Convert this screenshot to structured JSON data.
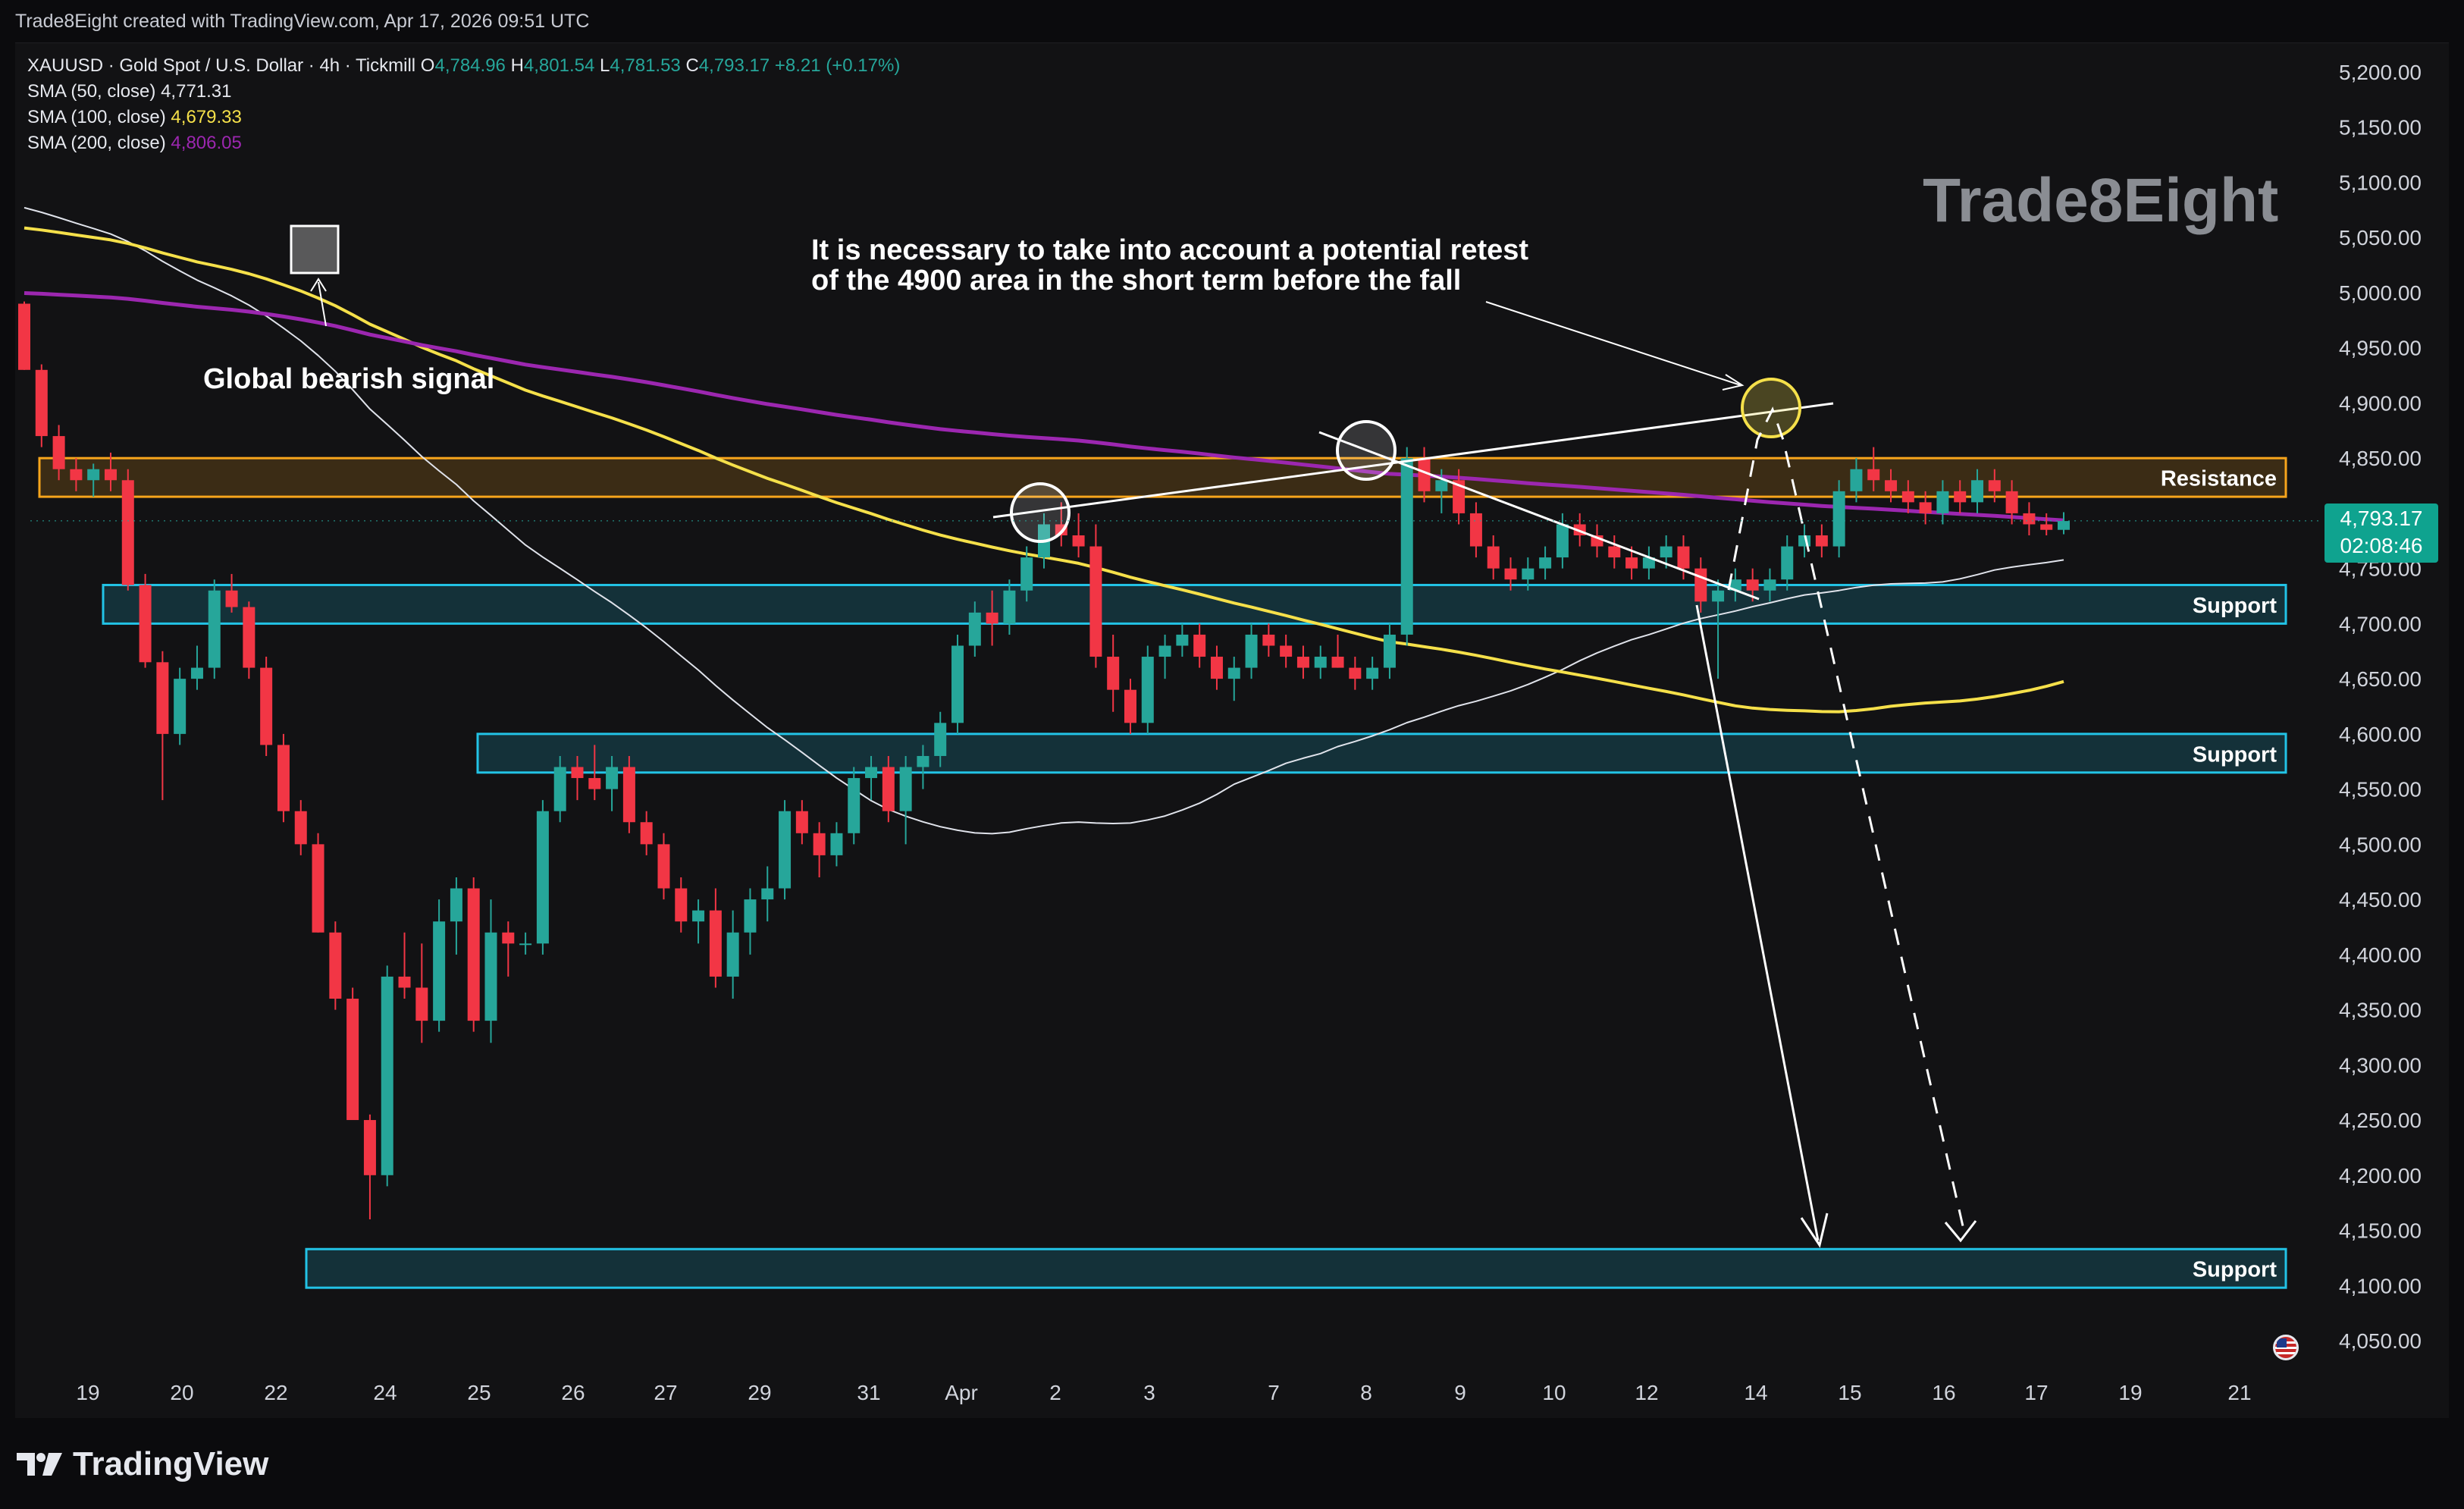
{
  "header": {
    "credit": "Trade8Eight created with TradingView.com, Apr 17, 2026 09:51 UTC"
  },
  "legend": {
    "symbol_line": "XAUUSD · Gold Spot / U.S. Dollar · 4h · Tickmill",
    "open_label": "O",
    "open": "4,784.96",
    "high_label": "H",
    "high": "4,801.54",
    "low_label": "L",
    "low": "4,781.53",
    "close_label": "C",
    "close": "4,793.17",
    "change": "+8.21 (+0.17%)",
    "sma50_label": "SMA (50, close)",
    "sma50_value": "4,771.31",
    "sma100_label": "SMA (100, close)",
    "sma100_value": "4,679.33",
    "sma200_label": "SMA (200, close)",
    "sma200_value": "4,806.05"
  },
  "brand": "Trade8Eight",
  "price_tag": {
    "price": "4,793.17",
    "countdown": "02:08:46"
  },
  "footer": {
    "logo_text": "TradingView"
  },
  "colors": {
    "up": "#26a69a",
    "down": "#f23645",
    "sma50": "#e0e3eb",
    "sma100": "#f5e04a",
    "sma200": "#9c27b0",
    "resistance": "#f7a51c",
    "support": "#22c3e6"
  },
  "chart_data": {
    "type": "candlestick",
    "symbol": "XAUUSD",
    "timeframe": "4h",
    "y_axis": {
      "ticks": [
        "5,200.00",
        "5,150.00",
        "5,100.00",
        "5,050.00",
        "5,000.00",
        "4,950.00",
        "4,900.00",
        "4,850.00",
        "4,800.00",
        "4,750.00",
        "4,700.00",
        "4,650.00",
        "4,600.00",
        "4,550.00",
        "4,500.00",
        "4,450.00",
        "4,400.00",
        "4,350.00",
        "4,300.00",
        "4,250.00",
        "4,200.00",
        "4,150.00",
        "4,100.00",
        "4,050.00"
      ],
      "range": [
        4020,
        5220
      ]
    },
    "x_axis": {
      "labels": [
        "19",
        "20",
        "22",
        "24",
        "25",
        "26",
        "27",
        "29",
        "31",
        "Apr",
        "2",
        "3",
        "7",
        "8",
        "9",
        "10",
        "12",
        "14",
        "15",
        "16",
        "17",
        "19",
        "21"
      ]
    },
    "zones": [
      {
        "label": "Resistance",
        "low": 4815,
        "high": 4850,
        "kind": "resistance"
      },
      {
        "label": "Support",
        "low": 4700,
        "high": 4735,
        "kind": "support"
      },
      {
        "label": "Support",
        "low": 4565,
        "high": 4600,
        "kind": "support"
      },
      {
        "label": "Support",
        "low": 4098,
        "high": 4133,
        "kind": "support"
      }
    ],
    "annotations": {
      "bearish_signal": "Global bearish signal",
      "retest_note_line1": "It is necessary to take into account a potential retest",
      "retest_note_line2": "of the 4900 area in the short term before the fall"
    },
    "candles": [
      [
        0,
        4990,
        4992,
        4930,
        4930
      ],
      [
        1,
        4930,
        4935,
        4860,
        4870
      ],
      [
        2,
        4870,
        4880,
        4830,
        4840
      ],
      [
        3,
        4840,
        4850,
        4820,
        4830
      ],
      [
        4,
        4830,
        4845,
        4815,
        4840
      ],
      [
        5,
        4840,
        4855,
        4820,
        4830
      ],
      [
        6,
        4830,
        4840,
        4730,
        4735
      ],
      [
        7,
        4735,
        4745,
        4660,
        4665
      ],
      [
        8,
        4665,
        4675,
        4540,
        4600
      ],
      [
        9,
        4600,
        4660,
        4590,
        4650
      ],
      [
        10,
        4650,
        4680,
        4640,
        4660
      ],
      [
        11,
        4660,
        4740,
        4650,
        4730
      ],
      [
        12,
        4730,
        4745,
        4710,
        4715
      ],
      [
        13,
        4715,
        4720,
        4650,
        4660
      ],
      [
        14,
        4660,
        4670,
        4580,
        4590
      ],
      [
        15,
        4590,
        4600,
        4520,
        4530
      ],
      [
        16,
        4530,
        4540,
        4490,
        4500
      ],
      [
        17,
        4500,
        4510,
        4420,
        4420
      ],
      [
        18,
        4420,
        4430,
        4350,
        4360
      ],
      [
        19,
        4360,
        4370,
        4260,
        4250
      ],
      [
        20,
        4250,
        4255,
        4160,
        4200
      ],
      [
        21,
        4200,
        4390,
        4190,
        4380
      ],
      [
        22,
        4380,
        4420,
        4360,
        4370
      ],
      [
        23,
        4370,
        4410,
        4320,
        4340
      ],
      [
        24,
        4340,
        4450,
        4330,
        4430
      ],
      [
        25,
        4430,
        4470,
        4400,
        4460
      ],
      [
        26,
        4460,
        4470,
        4330,
        4340
      ],
      [
        27,
        4340,
        4450,
        4320,
        4420
      ],
      [
        28,
        4420,
        4430,
        4380,
        4410
      ],
      [
        29,
        4410,
        4420,
        4400,
        4410
      ],
      [
        30,
        4410,
        4540,
        4400,
        4530
      ],
      [
        31,
        4530,
        4580,
        4520,
        4570
      ],
      [
        32,
        4570,
        4580,
        4540,
        4560
      ],
      [
        33,
        4560,
        4590,
        4540,
        4550
      ],
      [
        34,
        4550,
        4580,
        4530,
        4570
      ],
      [
        35,
        4570,
        4580,
        4510,
        4520
      ],
      [
        36,
        4520,
        4530,
        4490,
        4500
      ],
      [
        37,
        4500,
        4510,
        4450,
        4460
      ],
      [
        38,
        4460,
        4470,
        4420,
        4430
      ],
      [
        39,
        4430,
        4450,
        4410,
        4440
      ],
      [
        40,
        4440,
        4460,
        4370,
        4380
      ],
      [
        41,
        4380,
        4440,
        4360,
        4420
      ],
      [
        42,
        4420,
        4460,
        4400,
        4450
      ],
      [
        43,
        4450,
        4480,
        4430,
        4460
      ],
      [
        44,
        4460,
        4540,
        4450,
        4530
      ],
      [
        45,
        4530,
        4540,
        4500,
        4510
      ],
      [
        46,
        4510,
        4520,
        4470,
        4490
      ],
      [
        47,
        4490,
        4520,
        4480,
        4510
      ],
      [
        48,
        4510,
        4570,
        4500,
        4560
      ],
      [
        49,
        4560,
        4580,
        4540,
        4570
      ],
      [
        50,
        4570,
        4580,
        4520,
        4530
      ],
      [
        51,
        4530,
        4580,
        4500,
        4570
      ],
      [
        52,
        4570,
        4590,
        4550,
        4580
      ],
      [
        53,
        4580,
        4620,
        4570,
        4610
      ],
      [
        54,
        4610,
        4690,
        4600,
        4680
      ],
      [
        55,
        4680,
        4720,
        4670,
        4710
      ],
      [
        56,
        4710,
        4730,
        4680,
        4700
      ],
      [
        57,
        4700,
        4740,
        4690,
        4730
      ],
      [
        58,
        4730,
        4770,
        4720,
        4760
      ],
      [
        59,
        4760,
        4800,
        4750,
        4790
      ],
      [
        60,
        4790,
        4810,
        4770,
        4780
      ],
      [
        61,
        4780,
        4800,
        4760,
        4770
      ],
      [
        62,
        4770,
        4790,
        4660,
        4670
      ],
      [
        63,
        4670,
        4690,
        4620,
        4640
      ],
      [
        64,
        4640,
        4650,
        4600,
        4610
      ],
      [
        65,
        4610,
        4680,
        4600,
        4670
      ],
      [
        66,
        4670,
        4690,
        4650,
        4680
      ],
      [
        67,
        4680,
        4700,
        4670,
        4690
      ],
      [
        68,
        4690,
        4700,
        4660,
        4670
      ],
      [
        69,
        4670,
        4680,
        4640,
        4650
      ],
      [
        70,
        4650,
        4670,
        4630,
        4660
      ],
      [
        71,
        4660,
        4700,
        4650,
        4690
      ],
      [
        72,
        4690,
        4700,
        4670,
        4680
      ],
      [
        73,
        4680,
        4690,
        4660,
        4670
      ],
      [
        74,
        4670,
        4680,
        4650,
        4660
      ],
      [
        75,
        4660,
        4680,
        4650,
        4670
      ],
      [
        76,
        4670,
        4690,
        4660,
        4660
      ],
      [
        77,
        4660,
        4670,
        4640,
        4650
      ],
      [
        78,
        4650,
        4670,
        4640,
        4660
      ],
      [
        79,
        4660,
        4700,
        4650,
        4690
      ],
      [
        80,
        4690,
        4860,
        4680,
        4850
      ],
      [
        81,
        4850,
        4860,
        4810,
        4820
      ],
      [
        82,
        4820,
        4840,
        4800,
        4830
      ],
      [
        83,
        4830,
        4840,
        4790,
        4800
      ],
      [
        84,
        4800,
        4810,
        4760,
        4770
      ],
      [
        85,
        4770,
        4780,
        4740,
        4750
      ],
      [
        86,
        4750,
        4760,
        4730,
        4740
      ],
      [
        87,
        4740,
        4760,
        4730,
        4750
      ],
      [
        88,
        4750,
        4770,
        4740,
        4760
      ],
      [
        89,
        4760,
        4800,
        4750,
        4790
      ],
      [
        90,
        4790,
        4800,
        4770,
        4780
      ],
      [
        91,
        4780,
        4790,
        4760,
        4770
      ],
      [
        92,
        4770,
        4780,
        4750,
        4760
      ],
      [
        93,
        4760,
        4770,
        4740,
        4750
      ],
      [
        94,
        4750,
        4770,
        4740,
        4760
      ],
      [
        95,
        4760,
        4780,
        4750,
        4770
      ],
      [
        96,
        4770,
        4780,
        4740,
        4750
      ],
      [
        97,
        4750,
        4760,
        4710,
        4720
      ],
      [
        98,
        4720,
        4740,
        4650,
        4730
      ],
      [
        99,
        4730,
        4750,
        4720,
        4740
      ],
      [
        100,
        4740,
        4750,
        4720,
        4730
      ],
      [
        101,
        4730,
        4750,
        4720,
        4740
      ],
      [
        102,
        4740,
        4780,
        4730,
        4770
      ],
      [
        103,
        4770,
        4790,
        4760,
        4780
      ],
      [
        104,
        4780,
        4790,
        4760,
        4770
      ],
      [
        105,
        4770,
        4830,
        4760,
        4820
      ],
      [
        106,
        4820,
        4850,
        4810,
        4840
      ],
      [
        107,
        4840,
        4860,
        4820,
        4830
      ],
      [
        108,
        4830,
        4840,
        4810,
        4820
      ],
      [
        109,
        4820,
        4830,
        4800,
        4810
      ],
      [
        110,
        4810,
        4820,
        4790,
        4800
      ],
      [
        111,
        4800,
        4830,
        4790,
        4820
      ],
      [
        112,
        4820,
        4830,
        4800,
        4810
      ],
      [
        113,
        4810,
        4840,
        4800,
        4830
      ],
      [
        114,
        4830,
        4840,
        4810,
        4820
      ],
      [
        115,
        4820,
        4830,
        4790,
        4800
      ],
      [
        116,
        4800,
        4810,
        4780,
        4790
      ],
      [
        117,
        4790,
        4800,
        4780,
        4785
      ],
      [
        118,
        4785,
        4801,
        4781,
        4793
      ]
    ]
  }
}
